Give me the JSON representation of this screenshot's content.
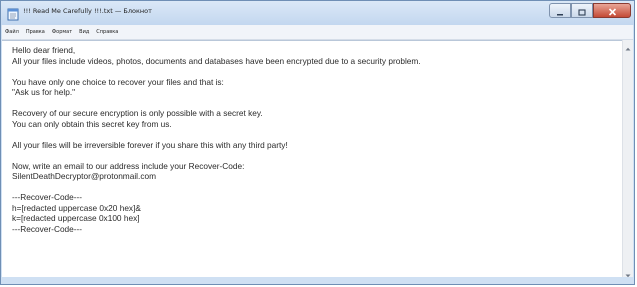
{
  "window": {
    "title": "!!! Read Me Carefully !!!.txt — Блокнот"
  },
  "menu": {
    "items": [
      "Файл",
      "Правка",
      "Формат",
      "Вид",
      "Справка"
    ]
  },
  "document": {
    "lines": [
      "Hello dear friend,",
      "All your files include videos, photos, documents and databases have been encrypted due to a security problem.",
      "",
      "You have only one choice to recover your files and that is:",
      "\"Ask us for help.\"",
      "",
      "Recovery of our secure encryption is only possible with a secret key.",
      "You can only obtain this secret key from us.",
      "",
      "All your files will be irreversible forever if you share this with any third party!",
      "",
      "Now, write an email to our address include your Recover-Code:",
      "SilentDeathDecryptor@protonmail.com",
      "",
      "---Recover-Code---",
      "h=[redacted uppercase 0x20 hex]&",
      "k=[redacted uppercase 0x100 hex]",
      "---Recover-Code---"
    ]
  },
  "icons": {
    "app": "notepad-icon",
    "minimize": "minimize-icon",
    "maximize": "maximize-icon",
    "close": "close-icon"
  }
}
